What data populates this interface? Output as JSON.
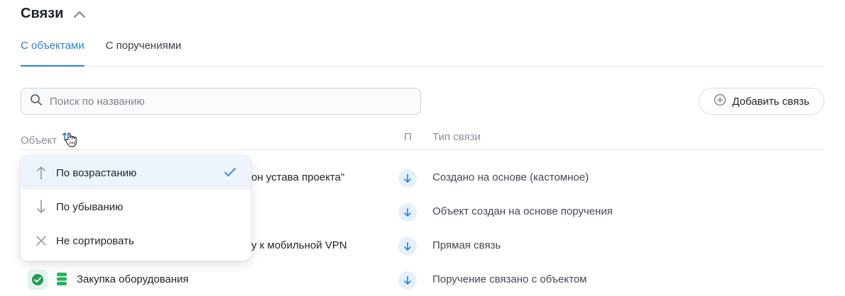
{
  "section": {
    "title": "Связи"
  },
  "tabs": [
    {
      "label": "С объектами",
      "active": true
    },
    {
      "label": "С поручениями",
      "active": false
    }
  ],
  "search": {
    "placeholder": "Поиск по названию",
    "value": ""
  },
  "add_button": {
    "label": "Добавить связь"
  },
  "table": {
    "headers": {
      "object": "Объект",
      "p": "П",
      "type": "Тип связи"
    },
    "rows": [
      {
        "name_visible": "он устава проекта\"",
        "direction": "down",
        "type": "Создано на основе (кастомное)"
      },
      {
        "name_visible": "",
        "direction": "down",
        "type": "Объект создан на основе поручения"
      },
      {
        "name_visible": "у к мобильной VPN",
        "direction": "down",
        "type": "Прямая связь"
      },
      {
        "name_visible": "Закупка оборудования",
        "direction": "down",
        "type": "Поручение связано с объектом",
        "status": "done",
        "icon": "database-icon"
      }
    ]
  },
  "sort_menu": {
    "items": [
      {
        "label": "По возрастанию",
        "icon": "arrow-up-icon",
        "selected": true
      },
      {
        "label": "По убыванию",
        "icon": "arrow-down-icon",
        "selected": false
      },
      {
        "label": "Не сортировать",
        "icon": "close-icon",
        "selected": false
      }
    ]
  },
  "colors": {
    "accent": "#2a7de1",
    "success": "#1f9d55",
    "text": "#1f2329",
    "muted": "#8a9098"
  }
}
